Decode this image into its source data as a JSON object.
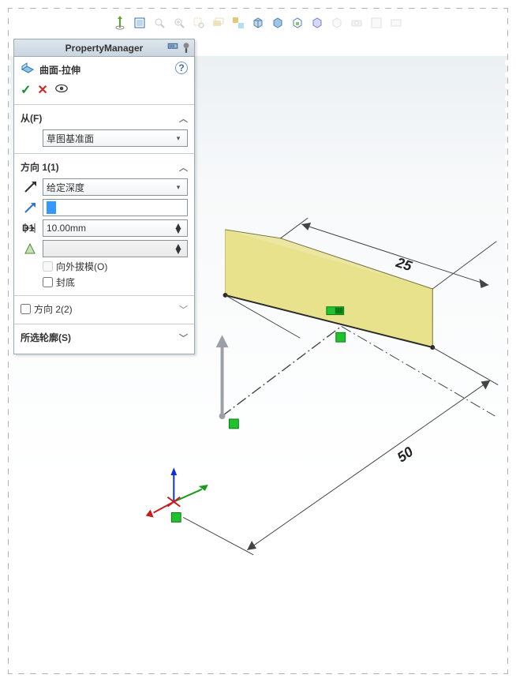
{
  "toolbar": {
    "icons": [
      "plane-indicator",
      "orientation",
      "fit",
      "zoom",
      "zoom-area",
      "pan",
      "rotate",
      "view-orientation",
      "display-style",
      "draft",
      "section",
      "scene",
      "camera",
      "render",
      "more"
    ]
  },
  "pm": {
    "title": "PropertyManager",
    "feature_icon": "surface-extrude-icon",
    "feature_name": "曲面-拉伸",
    "actions": {
      "ok": "✓",
      "cancel": "✕"
    },
    "from": {
      "label": "从(F)",
      "value": "草图基准面"
    },
    "dir1": {
      "label": "方向 1(1)",
      "type_value": "给定深度",
      "depth_value": "10.00mm",
      "draft_outward_label": "向外拔模(O)",
      "cap_label": "封底"
    },
    "dir2": {
      "label": "方向 2(2)"
    },
    "contours": {
      "label": "所选轮廓(S)"
    }
  },
  "viewport": {
    "dim25": "25",
    "dim50": "50"
  }
}
